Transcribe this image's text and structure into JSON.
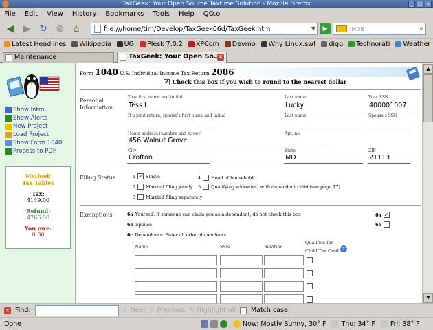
{
  "window": {
    "title": "TaxGeek: Your Open Source Taxtime Solution - Mozilla Firefox"
  },
  "menu": [
    "File",
    "Edit",
    "View",
    "History",
    "Bookmarks",
    "Tools",
    "Help",
    "QO.o"
  ],
  "nav": {
    "url": "file:///home/tim/Develop/TaxGeek06d/TaxGeek.htm",
    "search_placeholder": "IMDB"
  },
  "bookmarks": [
    {
      "label": "Latest Headlines",
      "color": "#f08a24"
    },
    {
      "label": "Wikipedia",
      "color": "#555555"
    },
    {
      "label": "UG",
      "color": "#333333"
    },
    {
      "label": "Plesk 7.0.2",
      "color": "#d03020"
    },
    {
      "label": "XPCom",
      "color": "#b02020"
    },
    {
      "label": "Devmo",
      "color": "#8a3a1a"
    },
    {
      "label": "Why Linux.swf",
      "color": "#333333"
    },
    {
      "label": "digg",
      "color": "#666666"
    },
    {
      "label": "Technorati",
      "color": "#2a9a2a"
    },
    {
      "label": "Weather",
      "color": "#3a8ad0"
    }
  ],
  "tabs": [
    {
      "label": "Maintenance"
    },
    {
      "label": "TaxGeek: Your Open So..."
    }
  ],
  "sidebar": {
    "links": [
      "Show Intro",
      "Show Alerts",
      "New Project",
      "Load Project",
      "Show Form 1040",
      "Process to PDF"
    ],
    "summary": {
      "method_label": "Method:",
      "method_value": "Tax Tables",
      "tax_label": "Tax:",
      "tax_value": "4149.00",
      "refund_label": "Refund:",
      "refund_value": "4766.00",
      "owe_label": "You owe:",
      "owe_value": "0.00"
    }
  },
  "form": {
    "header_prefix": "Form",
    "form_number": "1040",
    "header_title": "U.S. Individual Income Tax Return",
    "year": "2006",
    "round_checkbox_label": "Check this box if you wish to round to the nearest dollar",
    "personal": {
      "section": "Personal Information",
      "first_name_label": "Your first name and initial",
      "first_name": "Tess L",
      "last_name_label": "Last name",
      "last_name": "Lucky",
      "ssn_label": "Your SSN",
      "ssn": "400001007",
      "spouse_name_label": "If a joint return, spouse's first name and initial",
      "spouse_last_label": "Last name",
      "spouse_ssn_label": "Spouse's SSN",
      "address_label": "Home address (number and street)",
      "address": "456 Walnut Grove",
      "apt_label": "Apt. no.",
      "city_label": "City",
      "city": "Crofton",
      "state_label": "State",
      "state": "MD",
      "zip_label": "ZIP",
      "zip": "21113"
    },
    "filing": {
      "section": "Filing Status",
      "options": [
        {
          "num": "1",
          "label": "Single",
          "checked": true
        },
        {
          "num": "2",
          "label": "Married filing jointly",
          "checked": false
        },
        {
          "num": "3",
          "label": "Married filing separately",
          "checked": false
        },
        {
          "num": "4",
          "label": "Head of household",
          "checked": false
        },
        {
          "num": "5",
          "label": "Qualifying widow(er) with dependent child (see page 17)",
          "checked": false
        }
      ]
    },
    "exemptions": {
      "section": "Exemptions",
      "line6a": "6a",
      "yourself": "Yourself.  If someone can claim you as a dependent, do not check this box",
      "line6b": "6b",
      "spouse": "Spouse",
      "line6c": "6c",
      "dependents": "Dependents: Enter all other dependents",
      "right6a": "6a",
      "right6b": "6b",
      "col_name": "Name",
      "col_ssn": "SSN",
      "col_relation": "Relation",
      "col_qualifies": "Qualifies for",
      "col_qualifies2": "Child Tax Credit"
    }
  },
  "findbar": {
    "label": "Find:",
    "next": "Next",
    "previous": "Previous",
    "highlight": "Highlight all",
    "matchcase": "Match case"
  },
  "status": {
    "done": "Done",
    "weather_now": "Now: Mostly Sunny, 30° F",
    "weather_thu": "Thu: 34° F",
    "weather_fri": "Fri: 38° F"
  }
}
